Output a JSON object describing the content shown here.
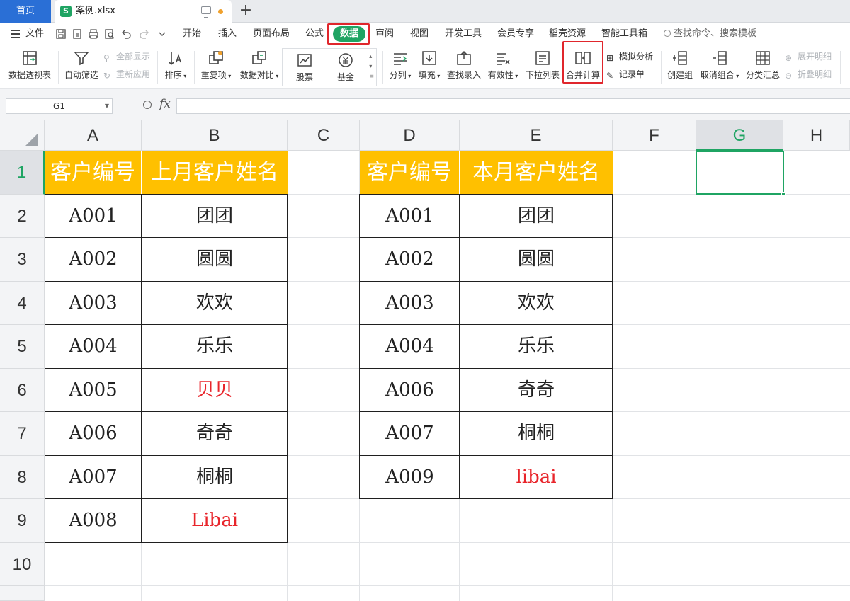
{
  "tabs": {
    "home_label": "首页",
    "file_icon_letter": "S",
    "file_name": "案例.xlsx"
  },
  "menu": {
    "file_label": "文件",
    "tabs": [
      "开始",
      "插入",
      "页面布局",
      "公式",
      "数据",
      "审阅",
      "视图",
      "开发工具",
      "会员专享",
      "稻壳资源",
      "智能工具箱"
    ],
    "active_tab": "数据",
    "search_placeholder": "查找命令、搜索模板"
  },
  "ribbon": {
    "pivot": "数据透视表",
    "autofilter": "自动筛选",
    "show_all": "全部显示",
    "reapply": "重新应用",
    "sort": "排序",
    "duplicates": "重复项",
    "compare": "数据对比",
    "stocks": "股票",
    "funds": "基金",
    "split": "分列",
    "fill": "填充",
    "lookup_entry": "查找录入",
    "validity": "有效性",
    "dropdown_list": "下拉列表",
    "consolidate": "合并计算",
    "whatif": "模拟分析",
    "record_form": "记录单",
    "create_group": "创建组",
    "ungroup": "取消组合",
    "subtotal": "分类汇总",
    "expand_detail": "展开明细",
    "collapse_detail": "折叠明细"
  },
  "formula_bar": {
    "name_box": "G1",
    "fx": "fx",
    "formula": ""
  },
  "columns": [
    "A",
    "B",
    "C",
    "D",
    "E",
    "F",
    "G",
    "H"
  ],
  "rows": [
    "1",
    "2",
    "3",
    "4",
    "5",
    "6",
    "7",
    "8",
    "9",
    "10"
  ],
  "selected_cell": "G1",
  "colors": {
    "header_fill": "#ffc000",
    "accent": "#1fa463",
    "highlight_red": "#e8252b",
    "home_tab": "#2a6fd6"
  },
  "table_left": {
    "headers": [
      "客户编号",
      "上月客户姓名"
    ],
    "rows": [
      [
        "A001",
        "团团"
      ],
      [
        "A002",
        "圆圆"
      ],
      [
        "A003",
        "欢欢"
      ],
      [
        "A004",
        "乐乐"
      ],
      [
        "A005",
        "贝贝"
      ],
      [
        "A006",
        "奇奇"
      ],
      [
        "A007",
        "桐桐"
      ],
      [
        "A008",
        "Libai"
      ]
    ],
    "red_names": [
      "贝贝",
      "Libai"
    ]
  },
  "table_right": {
    "headers": [
      "客户编号",
      "本月客户姓名"
    ],
    "rows": [
      [
        "A001",
        "团团"
      ],
      [
        "A002",
        "圆圆"
      ],
      [
        "A003",
        "欢欢"
      ],
      [
        "A004",
        "乐乐"
      ],
      [
        "A006",
        "奇奇"
      ],
      [
        "A007",
        "桐桐"
      ],
      [
        "A009",
        "libai"
      ]
    ],
    "red_names": [
      "libai"
    ]
  }
}
